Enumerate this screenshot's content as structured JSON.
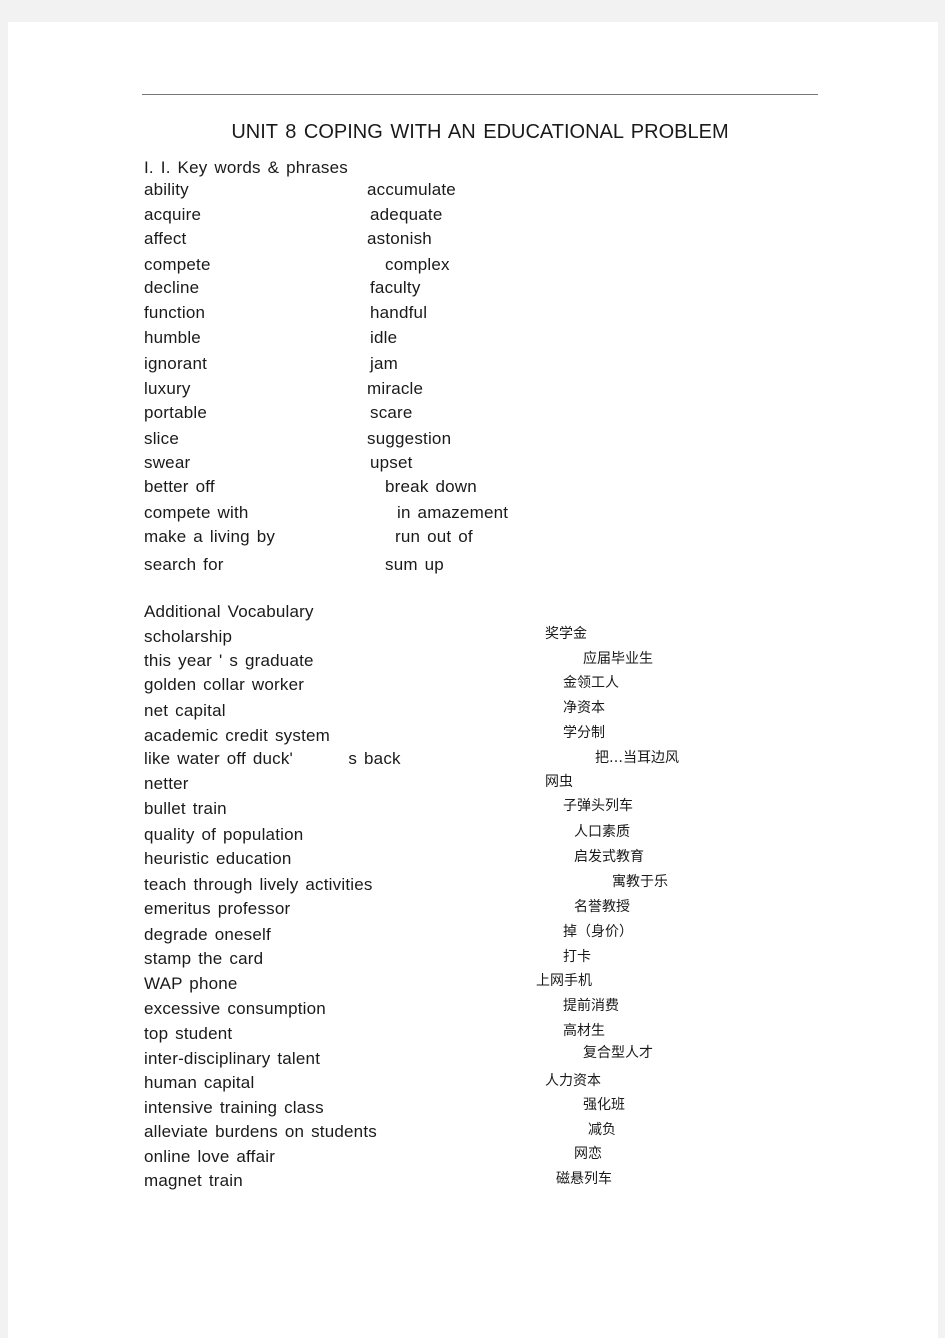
{
  "document": {
    "title": "UNIT 8 COPING WITH AN EDUCATIONAL PROBLEM",
    "section_key_words": "I. I. Key words & phrases",
    "key_words": [
      [
        "ability",
        "accumulate"
      ],
      [
        "acquire",
        "adequate"
      ],
      [
        "affect",
        "astonish"
      ],
      [
        "compete",
        "complex"
      ],
      [
        "decline",
        "faculty"
      ],
      [
        "function",
        "handful"
      ],
      [
        "humble",
        "idle"
      ],
      [
        "ignorant",
        "jam"
      ],
      [
        "luxury",
        "miracle"
      ],
      [
        "portable",
        "scare"
      ],
      [
        "slice",
        "suggestion"
      ],
      [
        "swear",
        "upset"
      ],
      [
        "better off",
        "break down"
      ],
      [
        "compete with",
        "in amazement"
      ],
      [
        "make a living by",
        "run out of"
      ],
      [
        "search for",
        "sum up"
      ]
    ],
    "section_additional": "Additional Vocabulary",
    "vocabulary": [
      {
        "en": "scholarship",
        "zh": "奖学金"
      },
      {
        "en": "this year ' s graduate",
        "zh": "应届毕业生"
      },
      {
        "en": "golden collar worker",
        "zh": "金领工人"
      },
      {
        "en": "net capital",
        "zh": "净资本"
      },
      {
        "en": "academic credit system",
        "zh": "学分制"
      },
      {
        "en": "like water off duck'        s back",
        "zh": "把…当耳边风"
      },
      {
        "en": "netter",
        "zh": "网虫"
      },
      {
        "en": "bullet train",
        "zh": "子弹头列车"
      },
      {
        "en": "quality of population",
        "zh": "人口素质"
      },
      {
        "en": "heuristic education",
        "zh": "启发式教育"
      },
      {
        "en": "teach through lively activities",
        "zh": "寓教于乐"
      },
      {
        "en": "emeritus professor",
        "zh": "名誉教授"
      },
      {
        "en": "degrade oneself",
        "zh": "掉（身价）"
      },
      {
        "en": "stamp the card",
        "zh": "打卡"
      },
      {
        "en": "WAP phone",
        "zh": "上网手机"
      },
      {
        "en": "excessive consumption",
        "zh": "提前消费"
      },
      {
        "en": "top student",
        "zh": "高材生"
      },
      {
        "en": "inter-disciplinary talent",
        "zh": "复合型人才"
      },
      {
        "en": "human capital",
        "zh": "人力资本"
      },
      {
        "en": "intensive training class",
        "zh": "强化班"
      },
      {
        "en": "alleviate burdens on students",
        "zh": "减负"
      },
      {
        "en": "online love affair",
        "zh": "网恋"
      },
      {
        "en": "magnet train",
        "zh": "磁悬列车"
      }
    ]
  }
}
